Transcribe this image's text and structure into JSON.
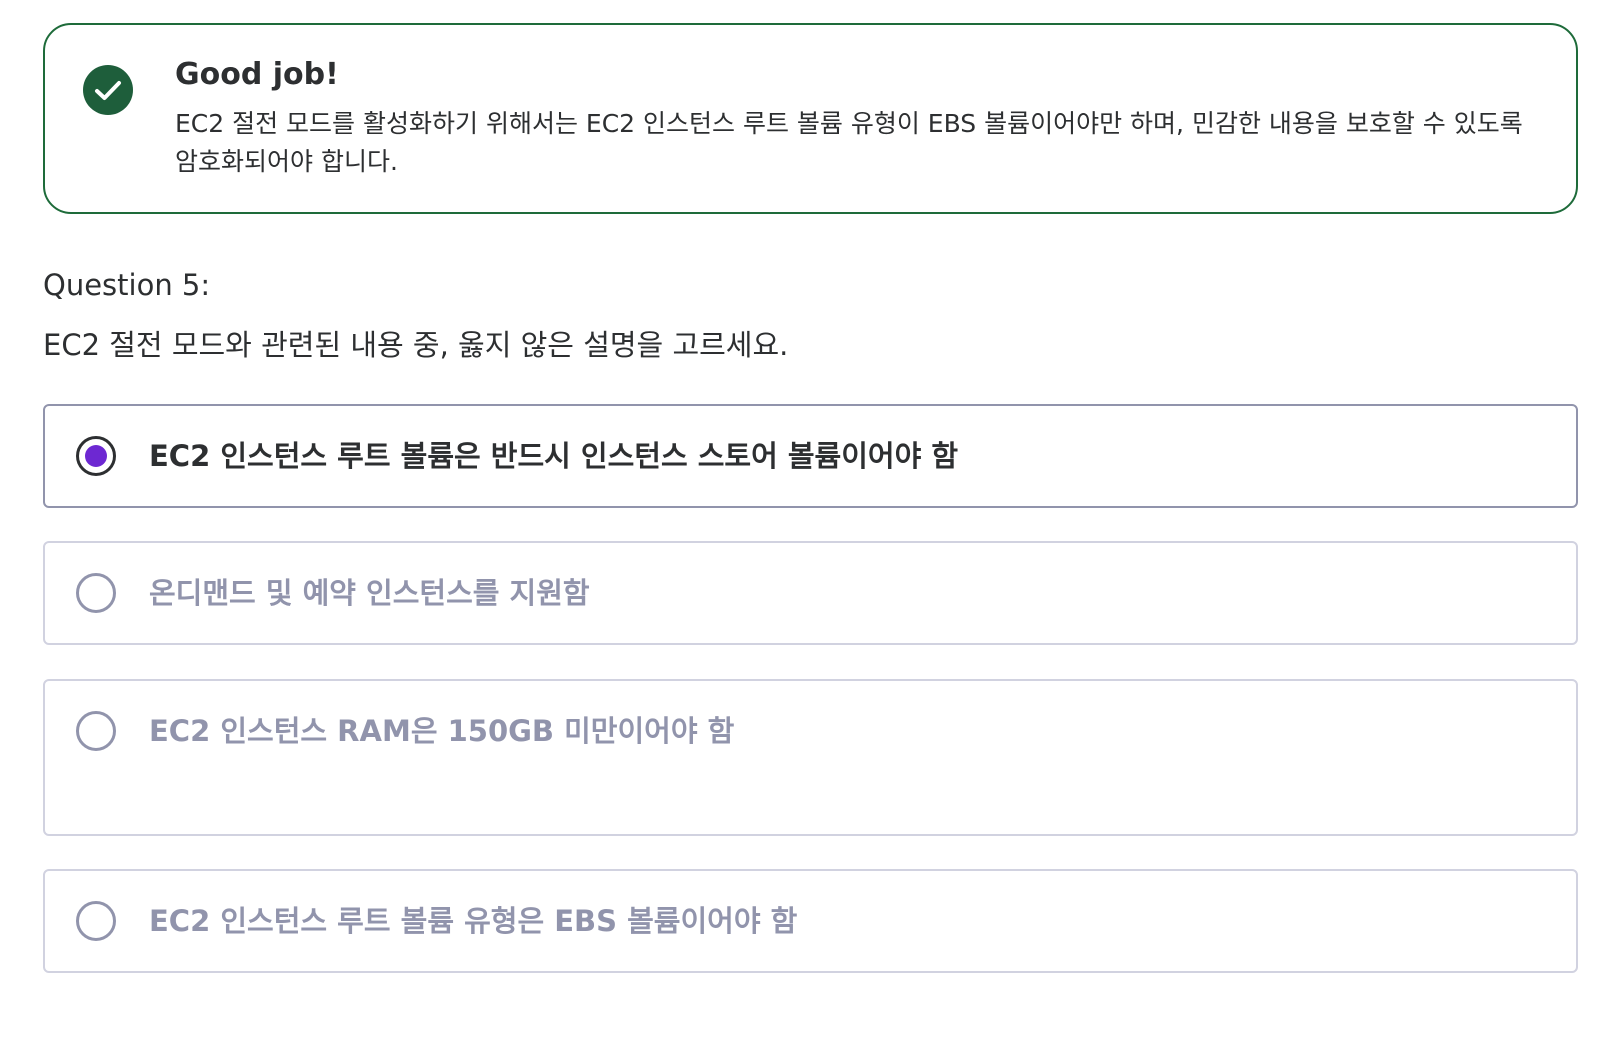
{
  "feedback": {
    "icon": "check-circle-icon",
    "title": "Good job!",
    "body": "EC2 절전 모드를 활성화하기 위해서는 EC2 인스턴스 루트 볼륨 유형이 EBS 볼륨이어야만 하며, 민감한 내용을 보호할 수 있도록 암호화되어야 합니다.",
    "accent_color": "#1e5e3b"
  },
  "question": {
    "label": "Question 5:",
    "text": "EC2 절전 모드와 관련된 내용 중, 옳지 않은 설명을 고르세요."
  },
  "options": [
    {
      "label": "EC2 인스턴스 루트 볼륨은 반드시 인스턴스 스토어 볼륨이어야 함",
      "selected": true
    },
    {
      "label": "온디맨드 및 예약 인스턴스를 지원함",
      "selected": false
    },
    {
      "label": "EC2 인스턴스 RAM은 150GB 미만이어야 함",
      "selected": false
    },
    {
      "label": "EC2 인스턴스 루트 볼륨 유형은 EBS 볼륨이어야 함",
      "selected": false
    }
  ],
  "colors": {
    "selected_radio": "#6d28d2",
    "muted_text": "#9194ac",
    "primary_text": "#2d2f31"
  }
}
